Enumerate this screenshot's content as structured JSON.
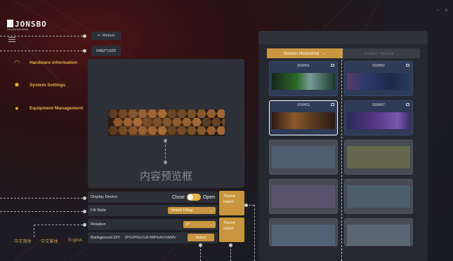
{
  "brand": {
    "wordmark": "JONSBO",
    "tagline": "For your real needs"
  },
  "window_controls": {
    "minimize": "−",
    "close": "×"
  },
  "nav": [
    {
      "label": "Hardware information",
      "icon": "speedometer-icon"
    },
    {
      "label": "System Settings",
      "icon": "gear-icon"
    },
    {
      "label": "Equipment Management",
      "icon": "user-icon"
    }
  ],
  "toolbar": {
    "return_label": "Return",
    "resolution": "0462*1920"
  },
  "preview": {
    "placeholder": "内容预览框"
  },
  "controls": {
    "display_device": {
      "label": "Display Device",
      "off": "Close",
      "on": "Open",
      "state": true
    },
    "fill_style": {
      "label": "Fill Style",
      "value": "Stretch Filling"
    },
    "rotation": {
      "label": "Rotation",
      "value": "0°"
    },
    "background": {
      "label": "Background DIY",
      "formats": "JPG/PNG/GIF/MP4/AVI/WMV",
      "button": "Select"
    }
  },
  "theme_buttons": {
    "import_l1": "Theme",
    "import_l2": "import",
    "export_l1": "Theme",
    "export_l2": "export"
  },
  "languages": [
    "中文简体",
    "中文繁体",
    "English"
  ],
  "themes": {
    "tab_horizontal": "Screen Horizontal",
    "tab_vertical": "Screen Vertical",
    "cards": [
      {
        "name": "916H01",
        "selected": false
      },
      {
        "name": "916H02",
        "selected": false
      },
      {
        "name": "916H03",
        "selected": true
      },
      {
        "name": "916H07",
        "selected": false
      }
    ]
  },
  "colors": {
    "accent": "#c9953e",
    "nav_text": "#e0b24a",
    "panel": "#2d2f36"
  }
}
